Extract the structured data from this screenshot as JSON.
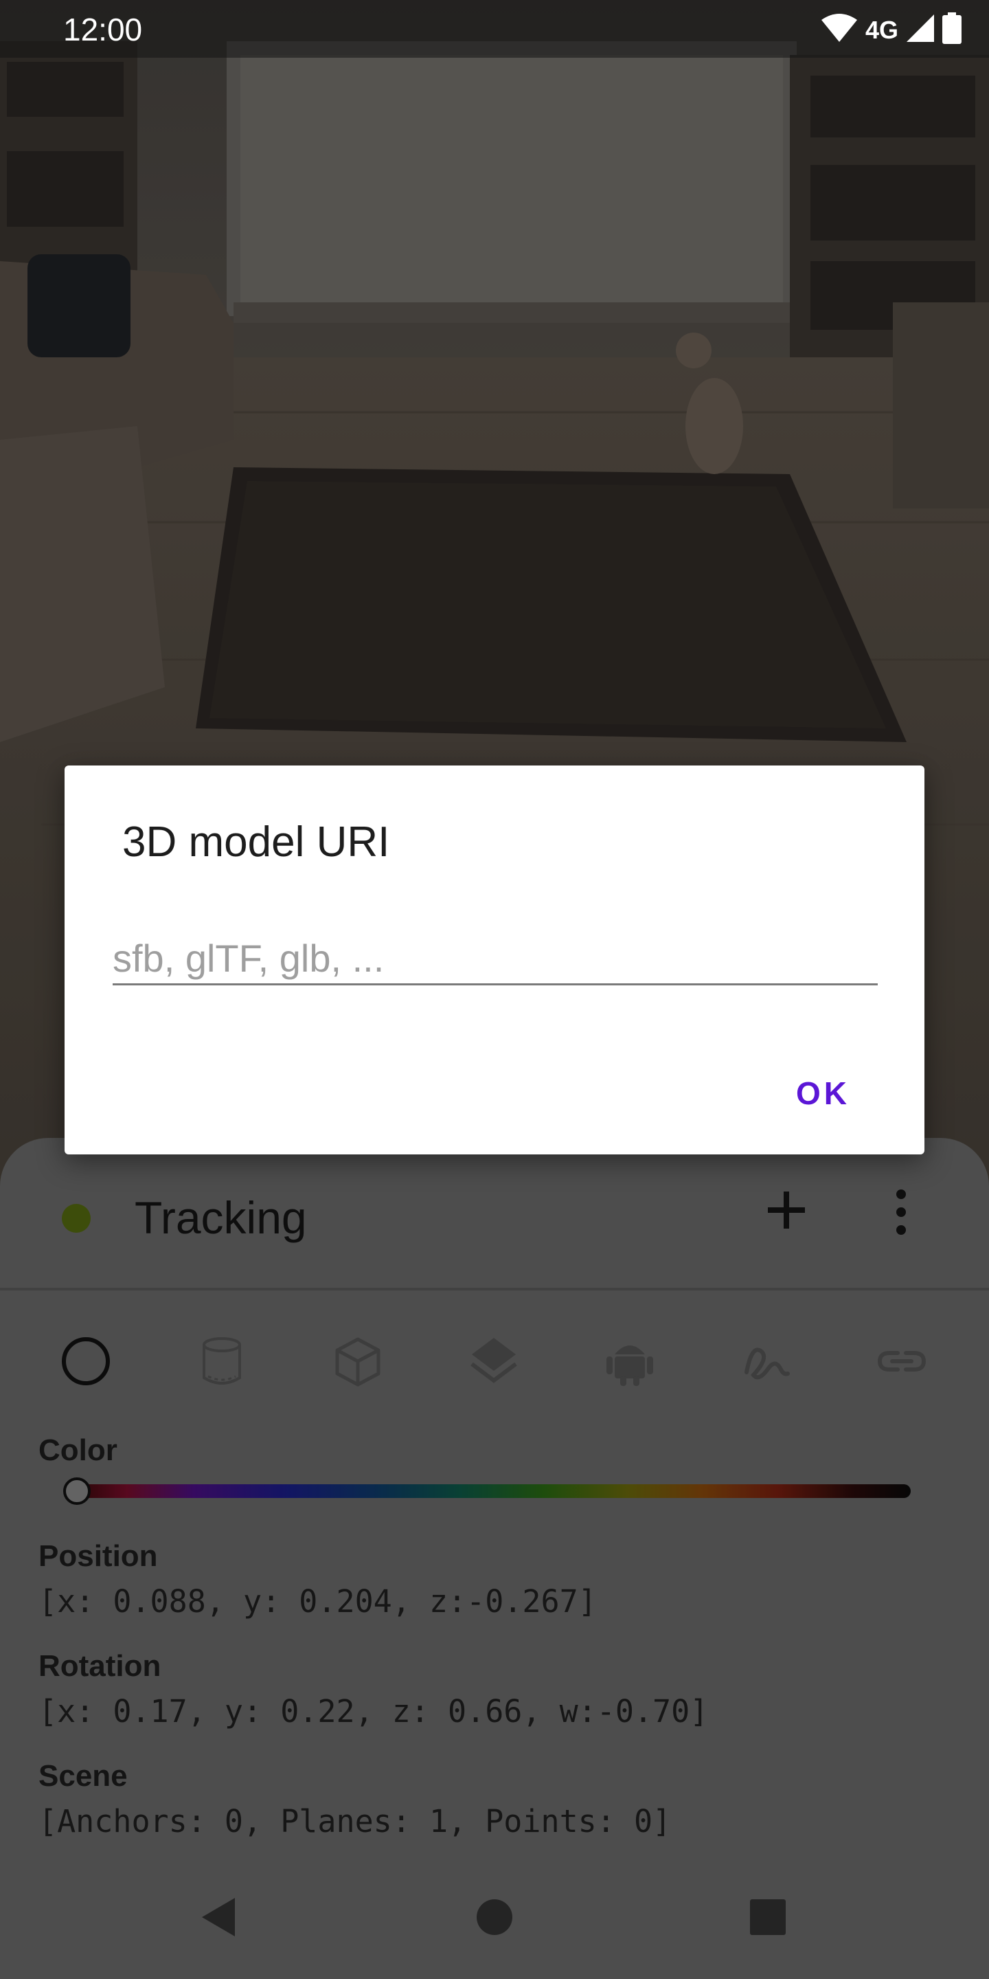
{
  "status_bar": {
    "time": "12:00",
    "network": "4G",
    "icons": [
      "wifi-icon",
      "cellular-signal-icon",
      "battery-icon"
    ]
  },
  "dialog": {
    "title": "3D model URI",
    "input_value": "",
    "input_placeholder": "sfb, glTF, glb, ...",
    "ok_label": "OK"
  },
  "sheet": {
    "title": "Tracking",
    "status_color": "#556b10",
    "tools": [
      "sphere-icon",
      "cylinder-icon",
      "cube-icon",
      "layers-icon",
      "android-icon",
      "draw-icon",
      "link-icon"
    ],
    "selected_tool": "sphere-icon",
    "color_label": "Color",
    "position_label": "Position",
    "position_value": "[x: 0.088, y: 0.204, z:-0.267]",
    "rotation_label": "Rotation",
    "rotation_value": "[x: 0.17, y: 0.22, z: 0.66, w:-0.70]",
    "scene_label": "Scene",
    "scene_value": "[Anchors: 0, Planes: 1, Points: 0]"
  },
  "nav": {
    "icons": [
      "back-icon",
      "home-icon",
      "recents-icon"
    ]
  },
  "colors": {
    "accent": "#5b16d6",
    "scrim": "#5f5f5f"
  }
}
